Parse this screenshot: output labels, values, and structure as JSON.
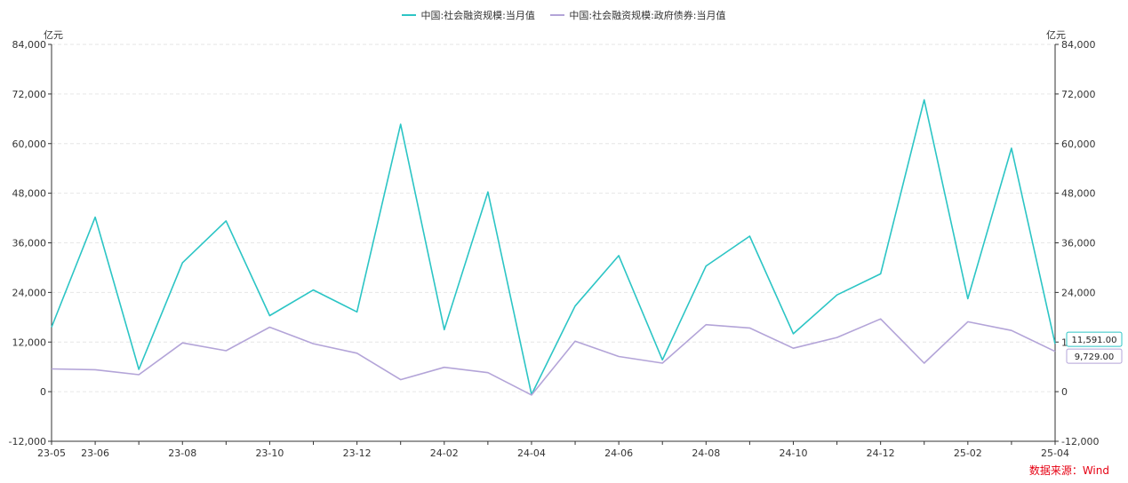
{
  "legend": [
    {
      "label": "中国:社会融资规模:当月值",
      "color": "#2cc5c5"
    },
    {
      "label": "中国:社会融资规模:政府债券:当月值",
      "color": "#b3a4d8"
    }
  ],
  "units": {
    "left": "亿元",
    "right": "亿元"
  },
  "source": "数据来源：Wind",
  "chart_data": {
    "type": "line",
    "x": [
      "23-05",
      "23-06",
      "23-07",
      "23-08",
      "23-09",
      "23-10",
      "23-11",
      "23-12",
      "24-01",
      "24-02",
      "24-03",
      "24-04",
      "24-05",
      "24-06",
      "24-07",
      "24-08",
      "24-09",
      "24-10",
      "24-11",
      "24-12",
      "25-01",
      "25-02",
      "25-03",
      "25-04"
    ],
    "x_tick_labels": [
      "23-05",
      "23-06",
      "23-08",
      "23-10",
      "23-12",
      "24-02",
      "24-04",
      "24-06",
      "24-08",
      "24-10",
      "24-12",
      "25-02",
      "25-04"
    ],
    "series": [
      {
        "name": "中国:社会融资规模:当月值",
        "color": "#2cc5c5",
        "values": [
          15600,
          42200,
          5400,
          31200,
          41300,
          18400,
          24600,
          19300,
          64700,
          15000,
          48300,
          -700,
          20700,
          32900,
          7700,
          30400,
          37600,
          14000,
          23400,
          28500,
          70600,
          22500,
          58900,
          11591
        ],
        "end_label": "11,591.00"
      },
      {
        "name": "中国:社会融资规模:政府债券:当月值",
        "color": "#b3a4d8",
        "values": [
          5500,
          5300,
          4100,
          11800,
          9900,
          15600,
          11600,
          9300,
          2900,
          5900,
          4600,
          -800,
          12200,
          8500,
          6900,
          16200,
          15400,
          10500,
          13100,
          17600,
          6900,
          16900,
          14800,
          9729
        ],
        "end_label": "9,729.00"
      }
    ],
    "y_ticks": [
      "84,000",
      "72,000",
      "60,000",
      "48,000",
      "36,000",
      "24,000",
      "12,000",
      "0",
      "-12,000"
    ],
    "ylim": [
      -12000,
      84000
    ],
    "grid": true,
    "legend_position": "top-center"
  }
}
